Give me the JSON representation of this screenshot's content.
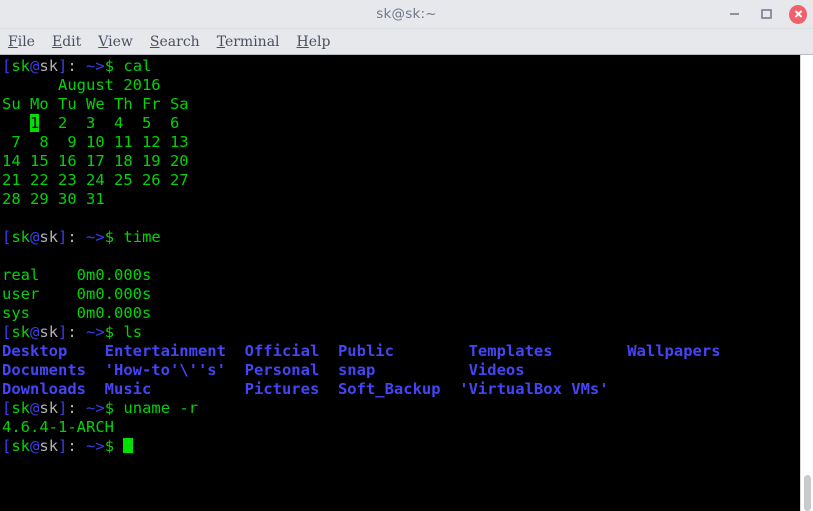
{
  "window": {
    "title": "sk@sk:~",
    "controls": {
      "minimize_label": "minimize",
      "maximize_label": "maximize",
      "close_label": "close"
    }
  },
  "menubar": {
    "items": [
      {
        "mnemonic": "F",
        "rest": "ile"
      },
      {
        "mnemonic": "E",
        "rest": "dit"
      },
      {
        "mnemonic": "V",
        "rest": "iew"
      },
      {
        "mnemonic": "S",
        "rest": "earch"
      },
      {
        "mnemonic": "T",
        "rest": "erminal"
      },
      {
        "mnemonic": "H",
        "rest": "elp"
      }
    ]
  },
  "terminal": {
    "prompt": {
      "open_bracket": "[",
      "user": "sk",
      "at": "@",
      "host": "sk",
      "close_bracket": "]",
      "colon": ":",
      "path": " ~>",
      "dollar": "$",
      "space": " "
    },
    "commands": {
      "cal": "cal",
      "time": "time",
      "ls": "ls",
      "uname": "uname -r"
    },
    "cal_output": {
      "header": "      August 2016",
      "weekdays": "Su Mo Tu We Th Fr Sa",
      "week1_pre": "   ",
      "week1_today": "1",
      "week1_post": "  2  3  4  5  6",
      "week2": " 7  8  9 10 11 12 13",
      "week3": "14 15 16 17 18 19 20",
      "week4": "21 22 23 24 25 26 27",
      "week5": "28 29 30 31"
    },
    "time_output": {
      "real": "real    0m0.000s",
      "user": "user    0m0.000s",
      "sys": "sys     0m0.000s"
    },
    "ls_output": {
      "row1": "Desktop    Entertainment  Official  Public        Templates        Wallpapers",
      "row2": "Documents  'How-to'\\''s'  Personal  snap          Videos",
      "row3": "Downloads  Music          Pictures  Soft_Backup  'VirtualBox VMs'"
    },
    "uname_output": "4.6.4-1-ARCH"
  },
  "colors": {
    "terminal_bg": "#000000",
    "green": "#00d407",
    "blue_bold": "#4545f5",
    "prompt_blue": "#3c3cf0",
    "highlight_bg": "#00e000",
    "chrome_bg": "#e7e8eb",
    "close_red": "#f0616d"
  }
}
